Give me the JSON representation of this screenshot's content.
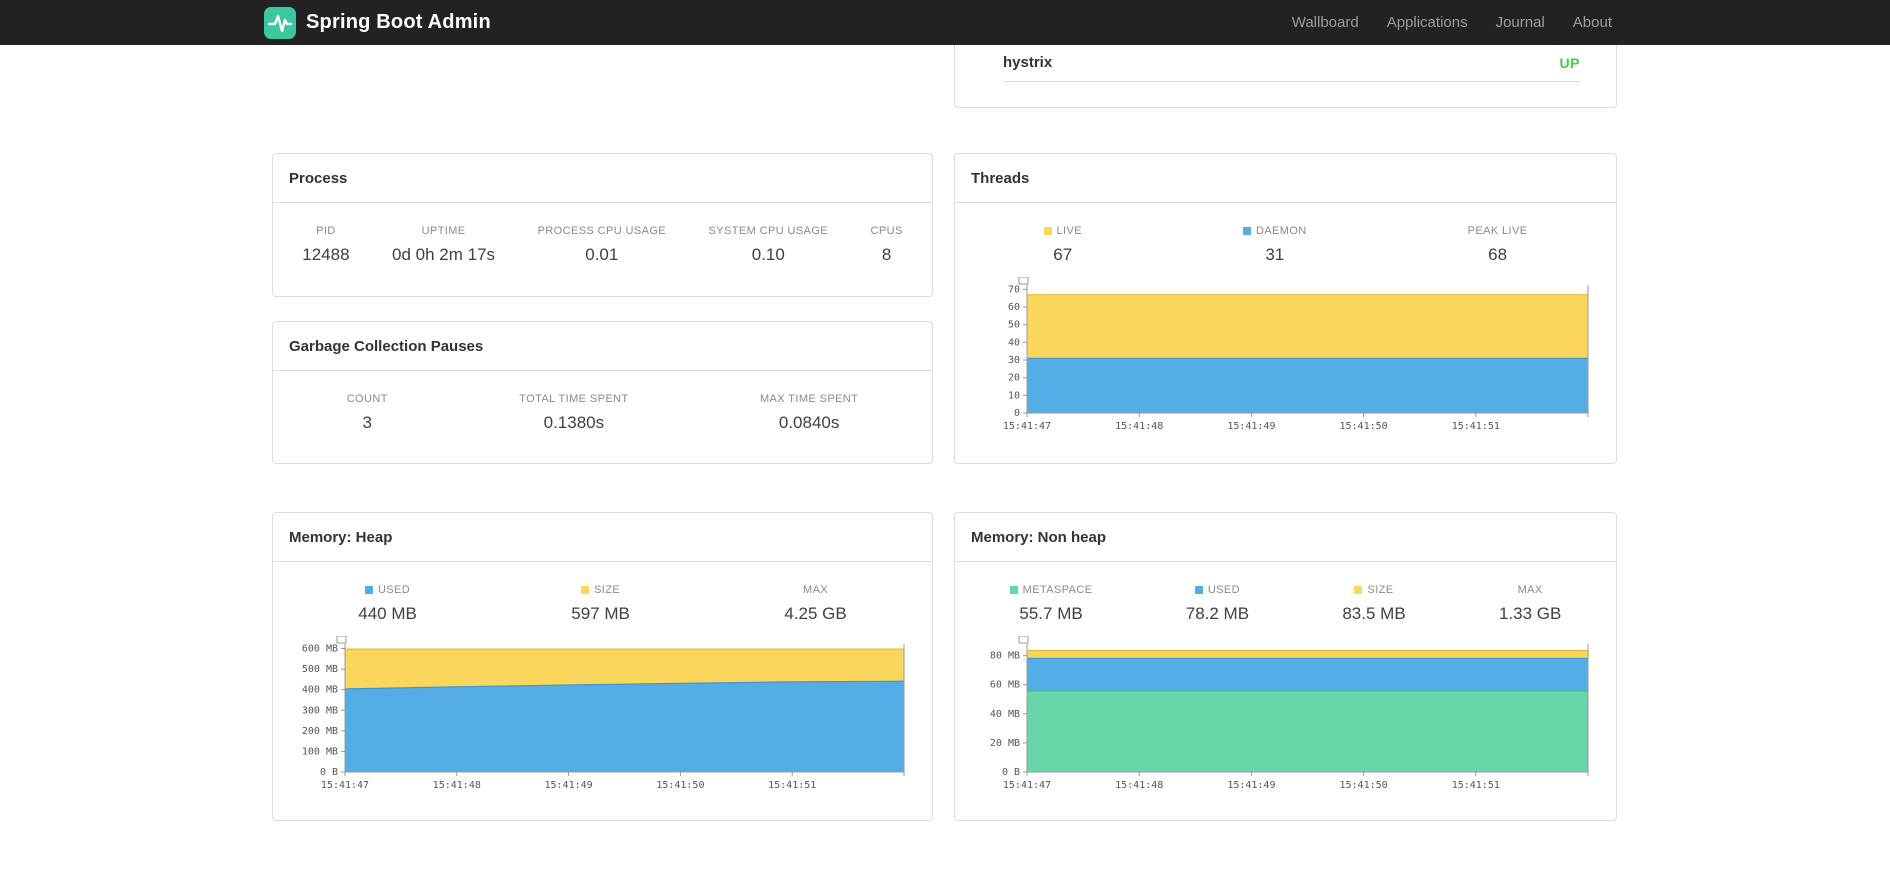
{
  "navbar": {
    "brand": "Spring Boot Admin",
    "links": [
      "Wallboard",
      "Applications",
      "Journal",
      "About"
    ]
  },
  "icons": {
    "brand": "pulse-icon"
  },
  "colors": {
    "yellow": "#FBD65D",
    "yellow_stroke": "#E3BC3F",
    "blue": "#54ADE4",
    "blue_stroke": "#3E97D1",
    "green": "#67D7A7",
    "green_stroke": "#3FBE8B",
    "up": "#3BD23B",
    "brand_green": "#3CC89E"
  },
  "application_panel": {
    "row": {
      "name": "hystrix",
      "status": "UP"
    }
  },
  "panels": {
    "process": {
      "title": "Process",
      "stats": [
        {
          "label": "PID",
          "value": "12488"
        },
        {
          "label": "UPTIME",
          "value": "0d 0h 2m 17s"
        },
        {
          "label": "PROCESS CPU USAGE",
          "value": "0.01"
        },
        {
          "label": "SYSTEM CPU USAGE",
          "value": "0.10"
        },
        {
          "label": "CPUS",
          "value": "8"
        }
      ]
    },
    "gc": {
      "title": "Garbage Collection Pauses",
      "stats": [
        {
          "label": "COUNT",
          "value": "3"
        },
        {
          "label": "TOTAL TIME SPENT",
          "value": "0.1380s"
        },
        {
          "label": "MAX TIME SPENT",
          "value": "0.0840s"
        }
      ]
    },
    "threads": {
      "title": "Threads",
      "stats": [
        {
          "label": "LIVE",
          "value": "67",
          "swatch": "yellow"
        },
        {
          "label": "DAEMON",
          "value": "31",
          "swatch": "blue"
        },
        {
          "label": "PEAK LIVE",
          "value": "68"
        }
      ]
    },
    "heap": {
      "title": "Memory: Heap",
      "stats": [
        {
          "label": "USED",
          "value": "440 MB",
          "swatch": "blue"
        },
        {
          "label": "SIZE",
          "value": "597 MB",
          "swatch": "yellow"
        },
        {
          "label": "MAX",
          "value": "4.25 GB"
        }
      ]
    },
    "nonheap": {
      "title": "Memory: Non heap",
      "stats": [
        {
          "label": "METASPACE",
          "value": "55.7 MB",
          "swatch": "green"
        },
        {
          "label": "USED",
          "value": "78.2 MB",
          "swatch": "blue"
        },
        {
          "label": "SIZE",
          "value": "83.5 MB",
          "swatch": "yellow"
        },
        {
          "label": "MAX",
          "value": "1.33 GB"
        }
      ]
    }
  },
  "chart_data": [
    {
      "id": "threads",
      "type": "area",
      "title": "Threads",
      "x_labels": [
        "15:41:47",
        "15:41:48",
        "15:41:49",
        "15:41:50",
        "15:41:51"
      ],
      "y_ticks": [
        {
          "v": 0,
          "label": "0"
        },
        {
          "v": 10,
          "label": "10"
        },
        {
          "v": 20,
          "label": "20"
        },
        {
          "v": 30,
          "label": "30"
        },
        {
          "v": 40,
          "label": "40"
        },
        {
          "v": 50,
          "label": "50"
        },
        {
          "v": 60,
          "label": "60"
        },
        {
          "v": 70,
          "label": "70"
        }
      ],
      "ylim": [
        0,
        72.5
      ],
      "grid": false,
      "series": [
        {
          "name": "LIVE",
          "color": "yellow",
          "values": [
            67,
            67,
            67,
            67,
            67,
            67
          ]
        },
        {
          "name": "DAEMON",
          "color": "blue",
          "values": [
            31,
            31,
            31,
            31,
            31,
            31
          ]
        }
      ]
    },
    {
      "id": "heap",
      "type": "area",
      "title": "Memory: Heap",
      "x_labels": [
        "15:41:47",
        "15:41:48",
        "15:41:49",
        "15:41:50",
        "15:41:51"
      ],
      "y_ticks": [
        {
          "v": 0,
          "label": "0 B"
        },
        {
          "v": 100,
          "label": "100 MB"
        },
        {
          "v": 200,
          "label": "200 MB"
        },
        {
          "v": 300,
          "label": "300 MB"
        },
        {
          "v": 400,
          "label": "400 MB"
        },
        {
          "v": 500,
          "label": "500 MB"
        },
        {
          "v": 600,
          "label": "600 MB"
        }
      ],
      "ylim": [
        0,
        622
      ],
      "grid": false,
      "series": [
        {
          "name": "SIZE",
          "color": "yellow",
          "values": [
            597,
            597,
            597,
            597,
            597,
            597
          ]
        },
        {
          "name": "USED",
          "color": "blue",
          "values": [
            404,
            414,
            423,
            431,
            438,
            441
          ]
        }
      ]
    },
    {
      "id": "nonheap",
      "type": "area",
      "title": "Memory: Non heap",
      "x_labels": [
        "15:41:47",
        "15:41:48",
        "15:41:49",
        "15:41:50",
        "15:41:51"
      ],
      "y_ticks": [
        {
          "v": 0,
          "label": "0 B"
        },
        {
          "v": 20,
          "label": "20 MB"
        },
        {
          "v": 40,
          "label": "40 MB"
        },
        {
          "v": 60,
          "label": "60 MB"
        },
        {
          "v": 80,
          "label": "80 MB"
        }
      ],
      "ylim": [
        0,
        88
      ],
      "grid": false,
      "series": [
        {
          "name": "SIZE",
          "color": "yellow",
          "values": [
            83.5,
            83.5,
            83.5,
            83.5,
            83.5,
            83.5
          ]
        },
        {
          "name": "USED",
          "color": "blue",
          "values": [
            78.2,
            78.2,
            78.2,
            78.2,
            78.2,
            78.2
          ]
        },
        {
          "name": "METASPACE",
          "color": "green",
          "values": [
            55.7,
            55.7,
            55.7,
            55.7,
            55.7,
            55.7
          ]
        }
      ]
    }
  ]
}
